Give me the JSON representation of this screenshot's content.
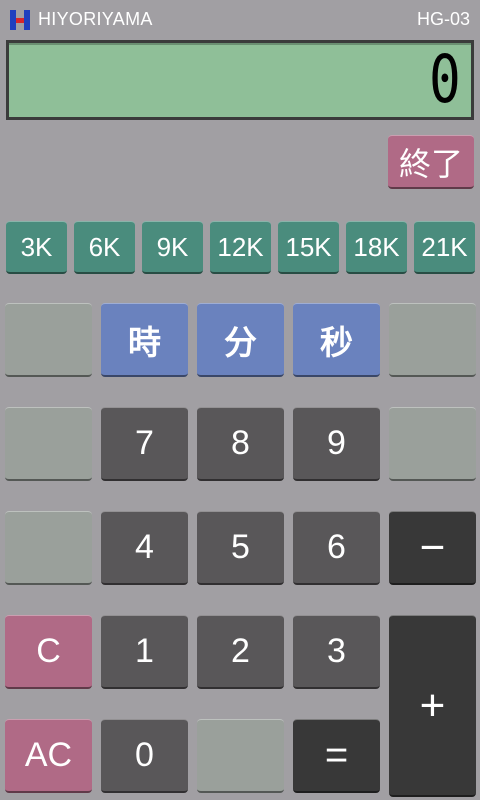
{
  "header": {
    "brand": "HIYORIYAMA",
    "model": "HG-03",
    "logo_icon": "h-logo-icon"
  },
  "display": {
    "value": "0"
  },
  "quit_label": "終了",
  "presets": [
    "3K",
    "6K",
    "9K",
    "12K",
    "15K",
    "18K",
    "21K"
  ],
  "time_units": {
    "hour": "時",
    "minute": "分",
    "second": "秒"
  },
  "digits": {
    "d0": "0",
    "d1": "1",
    "d2": "2",
    "d3": "3",
    "d4": "4",
    "d5": "5",
    "d6": "6",
    "d7": "7",
    "d8": "8",
    "d9": "9"
  },
  "ops": {
    "minus": "−",
    "plus": "+",
    "equals": "="
  },
  "clear": {
    "c": "C",
    "ac": "AC"
  },
  "colors": {
    "background": "#a19fa3",
    "display": "#8fbf98",
    "pink": "#b06a86",
    "teal": "#4a8c7d",
    "blue": "#6a82be",
    "dark": "#595759",
    "darker": "#383838",
    "blank": "#9aa09b"
  }
}
